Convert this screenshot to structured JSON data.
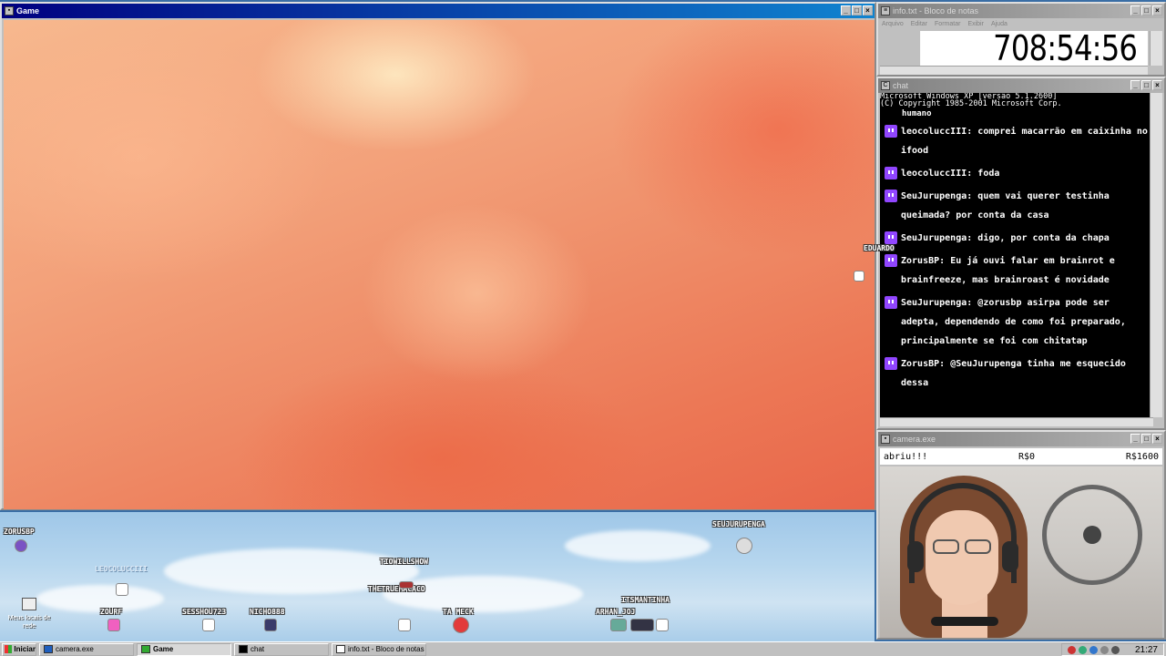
{
  "game_window": {
    "title": "Game",
    "buttons": [
      "_",
      "□",
      "×"
    ]
  },
  "stream_nicks": [
    {
      "name": "ZORUSBP"
    },
    {
      "name": "LEOCOLUCCIII"
    },
    {
      "name": "ZOURF"
    },
    {
      "name": "SESSHOU723"
    },
    {
      "name": "NICHO888"
    },
    {
      "name": "TIOWILLSHOW"
    },
    {
      "name": "THETRUEMACACO"
    },
    {
      "name": "TA MECK"
    },
    {
      "name": "ITSMANTINHA"
    },
    {
      "name": "ARHAN_JOJ"
    },
    {
      "name": "SEUJURUPENGA"
    },
    {
      "name": "EDUARDO"
    }
  ],
  "desktop_icon_label": "Meus locais de rede",
  "notepad": {
    "title": "info.txt - Bloco de notas",
    "menu": [
      "Arquivo",
      "Editar",
      "Formatar",
      "Exibir",
      "Ajuda"
    ],
    "content": "708:54:56"
  },
  "chat": {
    "title": "chat",
    "system_lines": [
      "Microsoft Windows XP [versão 5.1.2600]",
      "(C) Copyright 1985-2001 Microsoft Corp."
    ],
    "partial_line": "humano",
    "messages": [
      {
        "user": "leocoluccIII",
        "text": "comprei macarrão em caixinha no ifood"
      },
      {
        "user": "leocoluccIII",
        "text": "foda"
      },
      {
        "user": "SeuJurupenga",
        "text": "quem vai querer testinha queimada? por conta da casa"
      },
      {
        "user": "SeuJurupenga",
        "text": "digo, por conta da chapa"
      },
      {
        "user": "ZorusBP",
        "text": "Eu já ouvi falar em brainrot e brainfreeze, mas brainroast é novidade"
      },
      {
        "user": "SeuJurupenga",
        "text": "@zorusbp asirpa pode ser adepta, dependendo de como foi preparado, principalmente se foi com chitatap"
      },
      {
        "user": "ZorusBP",
        "text": "@SeuJurupenga tinha me esquecido dessa"
      }
    ]
  },
  "camera": {
    "title": "camera.exe",
    "goal_label": "abriu!!!",
    "goal_current": "R$0",
    "goal_target": "R$1600"
  },
  "taskbar": {
    "start_label": "Iniciar",
    "tasks": [
      {
        "label": "camera.exe"
      },
      {
        "label": "Game"
      },
      {
        "label": "chat"
      },
      {
        "label": "info.txt - Bloco de notas"
      }
    ],
    "clock": "21:27"
  }
}
